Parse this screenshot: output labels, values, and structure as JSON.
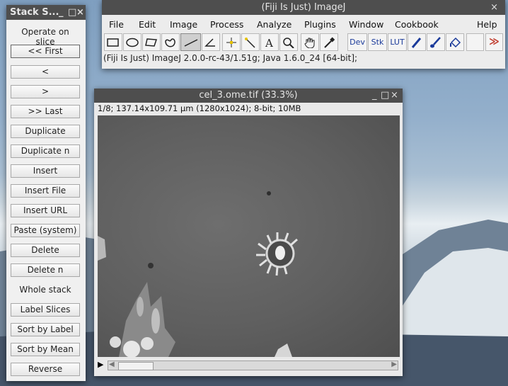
{
  "stack_window": {
    "title": "Stack S...",
    "heading": "Operate on slice",
    "buttons": [
      "<< First",
      "<",
      ">",
      ">> Last",
      "Duplicate",
      "Duplicate n",
      "Insert",
      "Insert File",
      "Insert URL",
      "Paste (system)",
      "Delete",
      "Delete n"
    ],
    "subheading": "Whole stack",
    "buttons2": [
      "Label Slices",
      "Sort by Label",
      "Sort by Mean",
      "Reverse"
    ],
    "minimize": "_",
    "restore": "□",
    "close": "×"
  },
  "imagej": {
    "title": "(Fiji Is Just) ImageJ",
    "close": "×",
    "menus": [
      "File",
      "Edit",
      "Image",
      "Process",
      "Analyze",
      "Plugins",
      "Window",
      "Cookbook",
      "Help"
    ],
    "tools": {
      "dev": "Dev",
      "stk": "Stk",
      "lut": "LUT",
      "more": "≫"
    },
    "status": "(Fiji Is Just) ImageJ 2.0.0-rc-43/1.51g; Java 1.6.0_24 [64-bit];"
  },
  "image_window": {
    "title": "cel_3.ome.tif (33.3%)",
    "info": "1/8; 137.14x109.71 µm (1280x1024); 8-bit; 10MB",
    "minimize": "_",
    "restore": "□",
    "close": "×",
    "play": "▶",
    "scroll_left": "◀",
    "scroll_right": "▶"
  },
  "colors": {
    "titlebar": "#4e4e4e",
    "more_tools": "#c0392b"
  }
}
